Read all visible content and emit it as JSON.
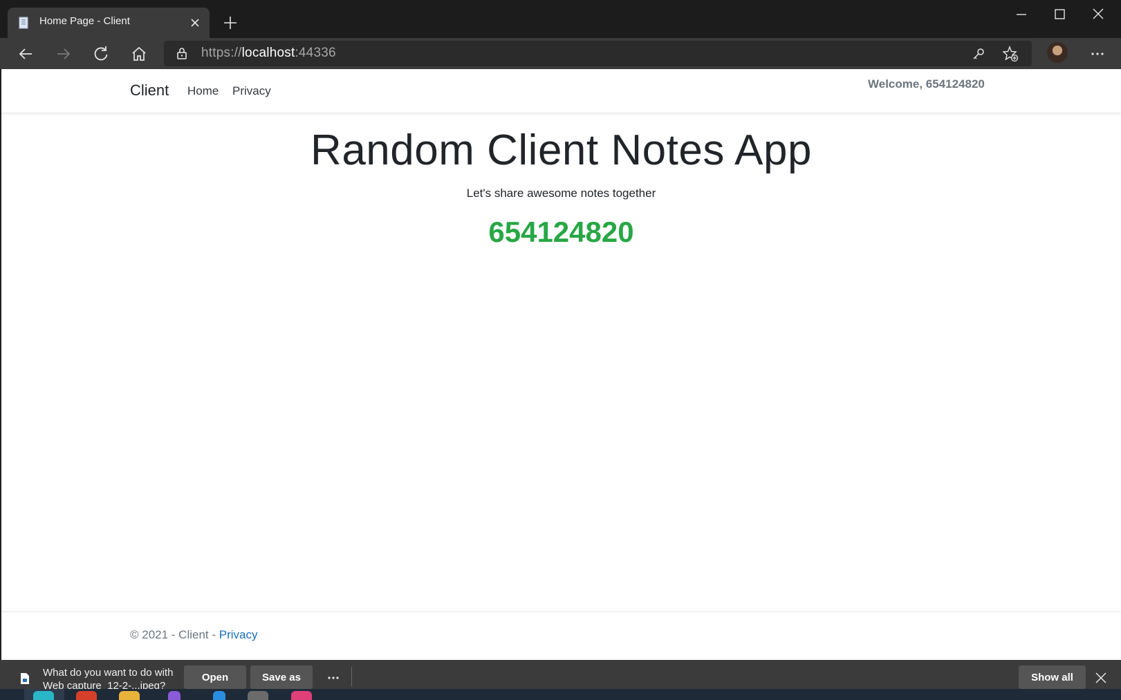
{
  "browser": {
    "tab": {
      "title": "Home Page - Client",
      "favicon": "page-icon"
    },
    "address_bar": {
      "url_scheme": "https://",
      "url_host": "localhost",
      "url_port": ":44336"
    },
    "toolbar_icons": [
      "back-arrow-icon",
      "forward-arrow-icon",
      "refresh-icon",
      "home-icon",
      "lock-icon",
      "key-icon",
      "add-favorite-icon",
      "profile-avatar",
      "more-icon"
    ],
    "window_controls": [
      "minimize-icon",
      "maximize-icon",
      "close-icon"
    ]
  },
  "page": {
    "navbar": {
      "brand": "Client",
      "links": [
        "Home",
        "Privacy"
      ],
      "welcome": "Welcome, 654124820"
    },
    "hero": {
      "title": "Random Client Notes App",
      "subtitle": "Let's share awesome notes together",
      "client_id": "654124820"
    },
    "footer": {
      "text": "© 2021 - Client - ",
      "link": "Privacy"
    }
  },
  "download_bar": {
    "prompt": "What do you want to do with Web capture_12-2-...jpeg?",
    "open_label": "Open",
    "save_as_label": "Save as",
    "show_all_label": "Show all"
  },
  "colors": {
    "accent_green": "#28a745",
    "link_blue": "#1b6ec2",
    "chrome_dark": "#3b3b3b"
  }
}
